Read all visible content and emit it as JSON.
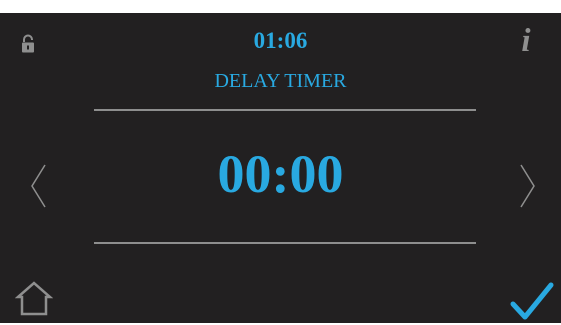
{
  "header": {
    "clock": "01:06",
    "title": "DELAY TIMER"
  },
  "timer": {
    "value": "00:00"
  },
  "icons": {
    "lock": "unlocked-padlock-icon",
    "info": "info-icon",
    "info_glyph": "i",
    "previous": "chevron-left-icon",
    "next": "chevron-right-icon",
    "home": "home-icon",
    "confirm": "checkmark-icon"
  },
  "colors": {
    "accent": "#29a9e1",
    "panel_background": "#222021",
    "icon_gray": "#8f8f8f",
    "divider": "#8e8e8e"
  }
}
